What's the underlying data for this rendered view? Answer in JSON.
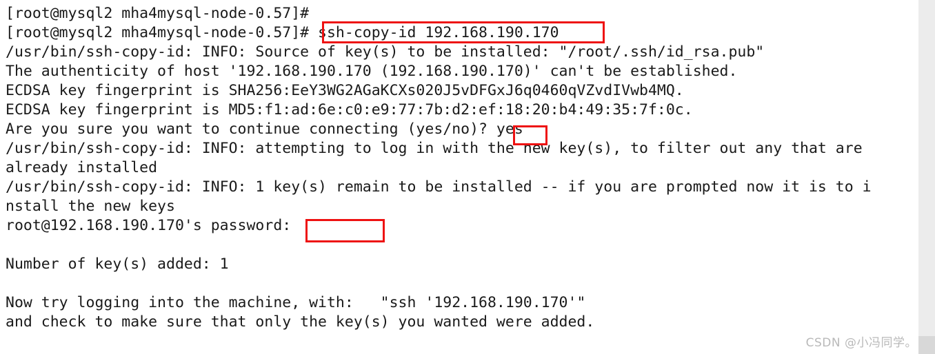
{
  "terminal": {
    "prompt": "[root@mysql2 mha4mysql-node-0.57]#",
    "lines": [
      "[root@mysql2 mha4mysql-node-0.57]#",
      "[root@mysql2 mha4mysql-node-0.57]# ssh-copy-id 192.168.190.170",
      "/usr/bin/ssh-copy-id: INFO: Source of key(s) to be installed: \"/root/.ssh/id_rsa.pub\"",
      "The authenticity of host '192.168.190.170 (192.168.190.170)' can't be established.",
      "ECDSA key fingerprint is SHA256:EeY3WG2AGaKCXs020J5vDFGxJ6q0460qVZvdIVwb4MQ.",
      "ECDSA key fingerprint is MD5:f1:ad:6e:c0:e9:77:7b:d2:ef:18:20:b4:49:35:7f:0c.",
      "Are you sure you want to continue connecting (yes/no)? yes",
      "/usr/bin/ssh-copy-id: INFO: attempting to log in with the new key(s), to filter out any that are",
      "already installed",
      "/usr/bin/ssh-copy-id: INFO: 1 key(s) remain to be installed -- if you are prompted now it is to i",
      "nstall the new keys",
      "root@192.168.190.170's password:",
      "",
      "Number of key(s) added: 1",
      "",
      "Now try logging into the machine, with:   \"ssh '192.168.190.170'\"",
      "and check to make sure that only the key(s) you wanted were added."
    ],
    "command": "ssh-copy-id 192.168.190.170",
    "target_host": "192.168.190.170",
    "identity_file": "/root/.ssh/id_rsa.pub",
    "fingerprint_sha256": "SHA256:EeY3WG2AGaKCXs020J5vDFGxJ6q0460qVZvdIVwb4MQ.",
    "fingerprint_md5": "MD5:f1:ad:6e:c0:e9:77:7b:d2:ef:18:20:b4:49:35:7f:0c.",
    "confirm_answer": "yes",
    "password_value": "",
    "keys_added": "1"
  },
  "annotations": {
    "box_color": "#ee1111",
    "command_box_label": "ssh-copy-id 192.168.190.170",
    "yes_box_label": "yes",
    "password_box_label": ""
  },
  "watermark": {
    "text": "CSDN @小冯同学。"
  },
  "colors": {
    "background": "#ffffff",
    "text": "#1a1a1a",
    "accent_red": "#ee1111",
    "gutter": "#ececec",
    "watermark": "#b9b9b9"
  }
}
